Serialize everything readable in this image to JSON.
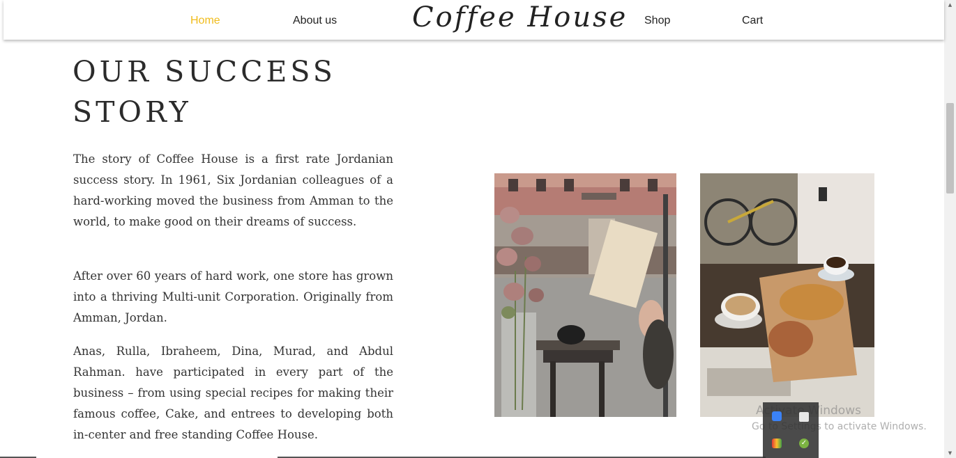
{
  "nav": {
    "home": "Home",
    "about": "About us",
    "brand": "Coffee House",
    "shop": "Shop",
    "cart": "Cart",
    "active_color": "#f0bc1c"
  },
  "story": {
    "heading_line1": "OUR SUCCESS",
    "heading_line2": "STORY",
    "paragraphs": [
      "The story of Coffee House is a first rate Jordanian success story. In 1961, Six Jordanian colleagues of a hard-working moved the business from Amman to the world, to make good on their dreams of success.",
      "After over 60 years of hard work, one store has grown into a thriving Multi-unit Corporation. Originally from Amman, Jordan.",
      "Anas, Rulla, Ibraheem, Dina, Murad, and Abdul Rahman. have participated in every part of the business – from using special recipes for making their famous coffee, Cake, and entrees to developing both in-center and free standing Coffee House."
    ]
  },
  "images": {
    "photo1": "cafe-window-roses-book-photo",
    "photo2": "coffee-croissant-table-photo"
  },
  "watermark": {
    "title": "Activate Windows",
    "subtitle": "Go to Settings to activate Windows."
  },
  "icons": {
    "tray": [
      "app-blue-icon",
      "note-icon",
      "colorful-app-icon",
      "check-shield-icon"
    ]
  }
}
